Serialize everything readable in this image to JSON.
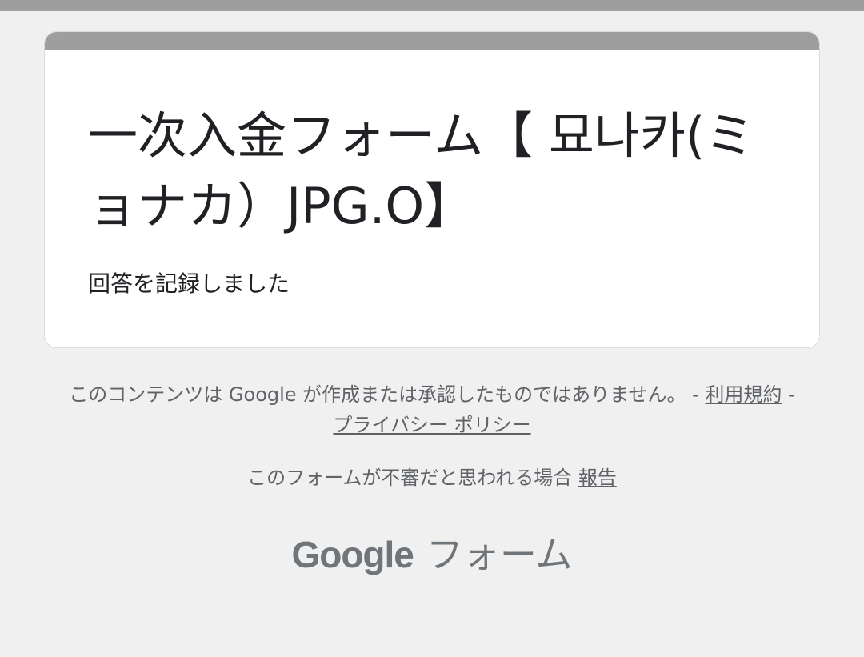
{
  "form": {
    "title": "一次入金フォーム【 묘나카(ミョナカ）JPG.O】",
    "confirmation": "回答を記録しました"
  },
  "footer": {
    "disclaimer_text": "このコンテンツは Google が作成または承認したものではありません。 - ",
    "terms_link": "利用規約",
    "separator": " - ",
    "privacy_link": "プライバシー ポリシー",
    "report_prefix": "このフォームが不審だと思われる場合 ",
    "report_link": "報告",
    "logo_google": "Google",
    "logo_forms": "フォーム"
  },
  "colors": {
    "page_background": "#f0f0f0",
    "card_accent": "#9e9e9e",
    "card_background": "#ffffff",
    "secondary_text": "#5f6368",
    "logo_text": "#70757a"
  }
}
